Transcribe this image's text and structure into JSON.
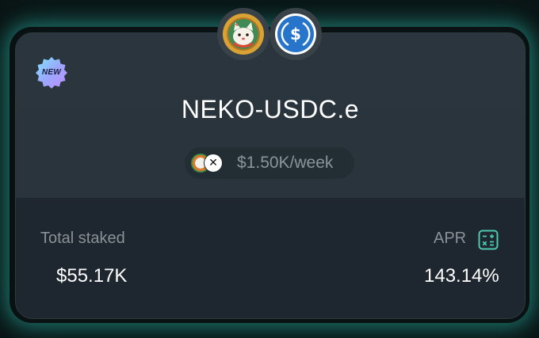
{
  "farm": {
    "badge_label": "NEW",
    "pair_name": "NEKO-USDC.e",
    "reward_rate": "$1.50K/week"
  },
  "stats": {
    "total_staked_label": "Total staked",
    "total_staked_value": "$55.17K",
    "apr_label": "APR",
    "apr_value": "143.14%"
  },
  "icons": {
    "token_a": "neko-cat-token-icon",
    "token_b": "usdc-token-icon",
    "reward_a": "neko-reward-icon",
    "reward_b": "x-reward-icon",
    "calculator": "calculator-icon",
    "badge": "new-badge-icon"
  },
  "colors": {
    "accent": "#4cc9b0",
    "usdc_blue": "#2775ca",
    "neko_gold": "#d9a234",
    "card_top": "#29343c",
    "card_bottom": "#1e272f"
  }
}
